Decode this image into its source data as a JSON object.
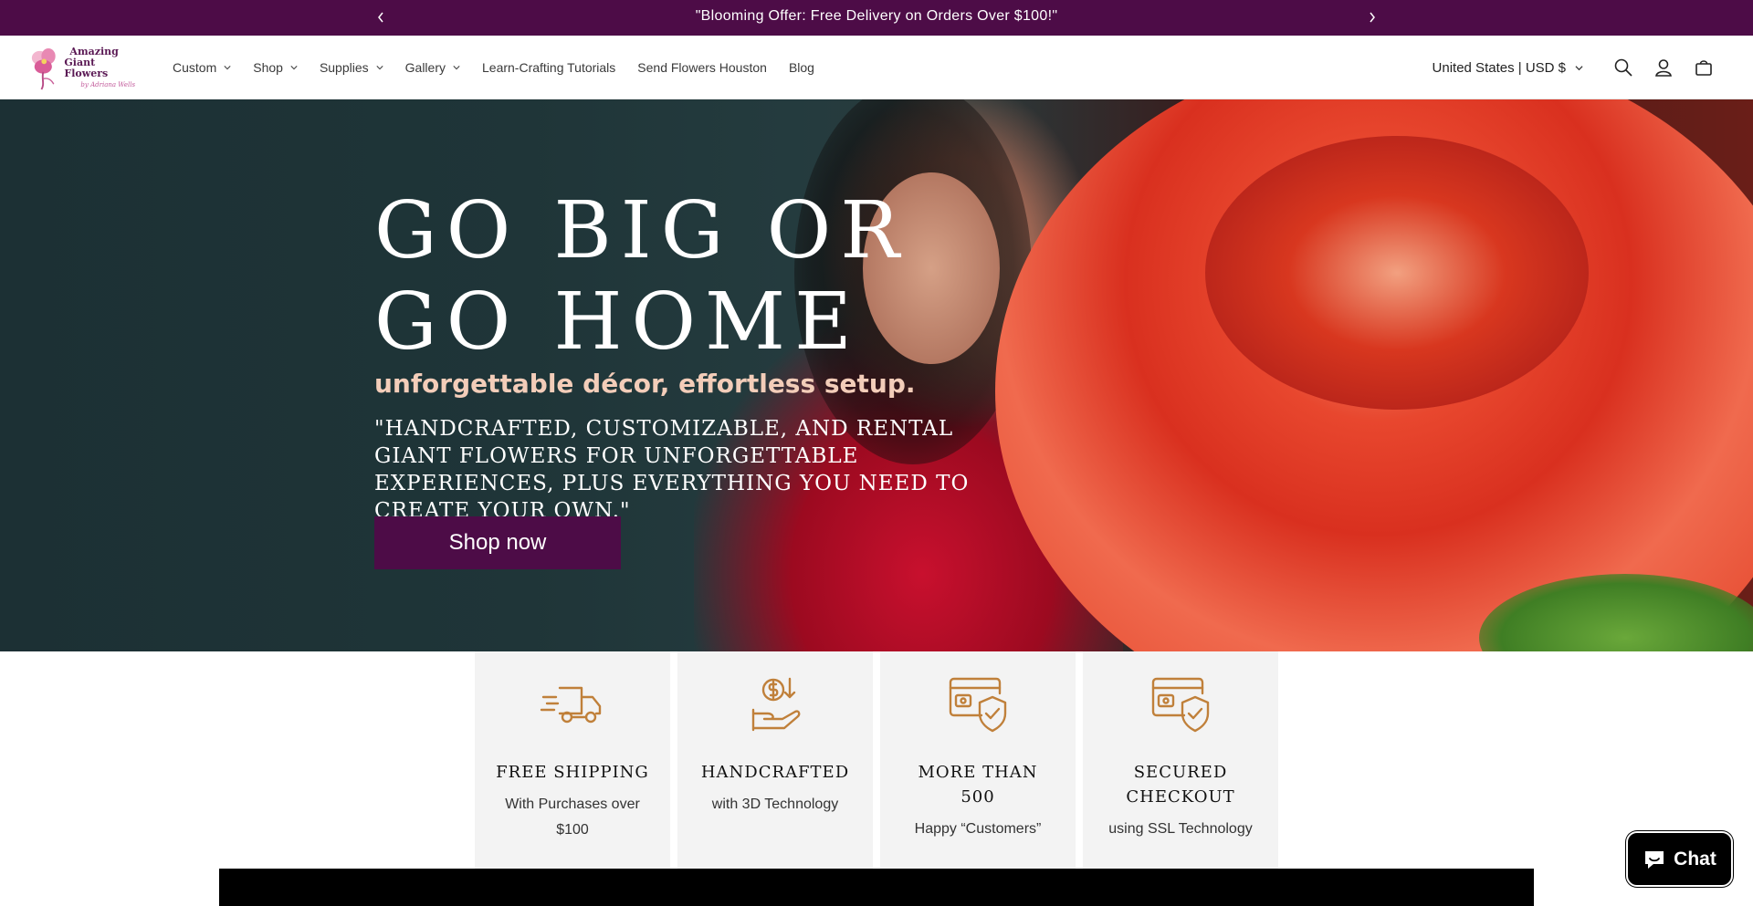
{
  "announcement": {
    "text": "\"Blooming Offer: Free Delivery on Orders Over $100!\""
  },
  "header": {
    "logo": {
      "line1": "Amazing",
      "line2": "Giant Flowers",
      "signature": "by Adriana Wells"
    },
    "nav": [
      {
        "label": "Custom",
        "dropdown": true
      },
      {
        "label": "Shop",
        "dropdown": true
      },
      {
        "label": "Supplies",
        "dropdown": true
      },
      {
        "label": "Gallery",
        "dropdown": true
      },
      {
        "label": "Learn-Crafting Tutorials",
        "dropdown": false
      },
      {
        "label": "Send Flowers Houston",
        "dropdown": false
      },
      {
        "label": "Blog",
        "dropdown": false
      }
    ],
    "locale": "United States | USD $",
    "icons": [
      "search-icon",
      "account-icon",
      "cart-icon"
    ]
  },
  "hero": {
    "title": "GO BIG OR\nGO HOME",
    "subtitle": "unforgettable décor, effortless setup.",
    "description": "\"Handcrafted, customizable, and rental giant flowers for unforgettable experiences, plus everything you need to create your own.\"",
    "button": "Shop now"
  },
  "features": [
    {
      "icon": "delivery-truck-icon",
      "title": "FREE SHIPPING",
      "text": "With Purchases over $100"
    },
    {
      "icon": "hand-money-icon",
      "title": "HANDCRAFTED",
      "text": "with 3D Technology"
    },
    {
      "icon": "card-shield-icon",
      "title": "MORE THAN 500",
      "text": "Happy “Customers”"
    },
    {
      "icon": "card-shield-icon",
      "title": "SECURED CHECKOUT",
      "text": "using SSL Technology"
    }
  ],
  "chat": {
    "label": "Chat"
  },
  "colors": {
    "brand": "#4d0c47",
    "icon_accent": "#c0803a"
  }
}
